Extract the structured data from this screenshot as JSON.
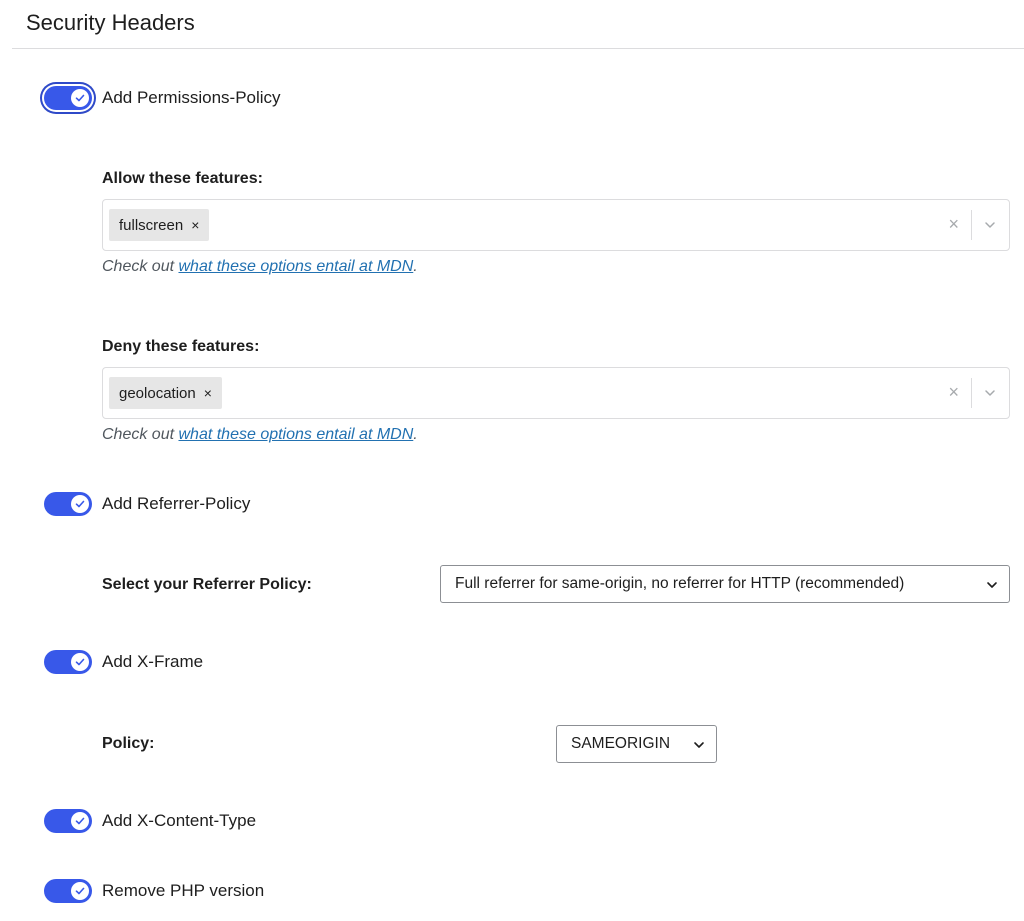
{
  "header": {
    "title": "Security Headers"
  },
  "permissions_policy": {
    "toggle_label": "Add Permissions-Policy",
    "enabled": true,
    "allow": {
      "label": "Allow these features:",
      "selected": [
        "fullscreen"
      ],
      "chip_remove": "×",
      "clear": "×",
      "hint_prefix": "Check out ",
      "hint_link": "what these options entail at MDN",
      "hint_suffix": "."
    },
    "deny": {
      "label": "Deny these features:",
      "selected": [
        "geolocation"
      ],
      "chip_remove": "×",
      "clear": "×",
      "hint_prefix": "Check out ",
      "hint_link": "what these options entail at MDN",
      "hint_suffix": "."
    }
  },
  "referrer_policy": {
    "toggle_label": "Add Referrer-Policy",
    "enabled": true,
    "select_label": "Select your Referrer Policy:",
    "selected_option": "Full referrer for same-origin, no referrer for HTTP (recommended)"
  },
  "x_frame": {
    "toggle_label": "Add X-Frame",
    "enabled": true,
    "select_label": "Policy:",
    "selected_option": "SAMEORIGIN"
  },
  "x_content_type": {
    "toggle_label": "Add X-Content-Type",
    "enabled": true
  },
  "php_version": {
    "toggle_label": "Remove PHP version",
    "enabled": true
  },
  "colors": {
    "accent": "#3858e9",
    "link": "#2271b1",
    "hint": "#50575e"
  }
}
